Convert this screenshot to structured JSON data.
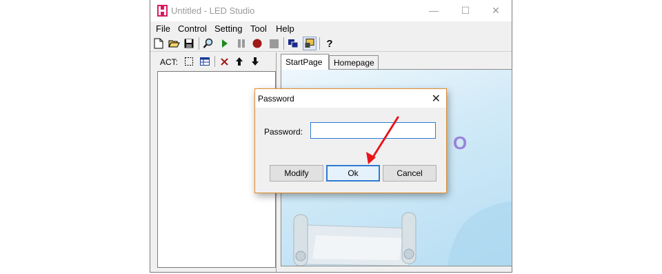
{
  "window": {
    "title": "Untitled - LED Studio",
    "minimize": "—",
    "maximize": "☐",
    "close": "✕"
  },
  "menu": [
    "File",
    "Control",
    "Setting",
    "Tool",
    "Help"
  ],
  "toolbar": {
    "icons": [
      "new-file-icon",
      "open-folder-icon",
      "save-icon",
      "find-icon",
      "play-icon",
      "pause-icon",
      "record-icon",
      "stop-icon",
      "windows-icon",
      "export-icon",
      "help-icon"
    ]
  },
  "left_panel": {
    "act_label": "ACT:",
    "icons": [
      "select-region-icon",
      "table-icon",
      "delete-icon",
      "move-up-icon",
      "move-down-icon"
    ]
  },
  "tabs": [
    "StartPage",
    "Homepage"
  ],
  "content": {
    "letter": "O"
  },
  "dialog": {
    "title": "Password",
    "close": "✕",
    "password_label": "Password:",
    "password_value": "",
    "buttons": {
      "modify": "Modify",
      "ok": "Ok",
      "cancel": "Cancel"
    }
  },
  "colors": {
    "accent": "#2c7bd2",
    "dialog_border": "#e08c2a",
    "annotation_arrow": "#e8141c"
  }
}
